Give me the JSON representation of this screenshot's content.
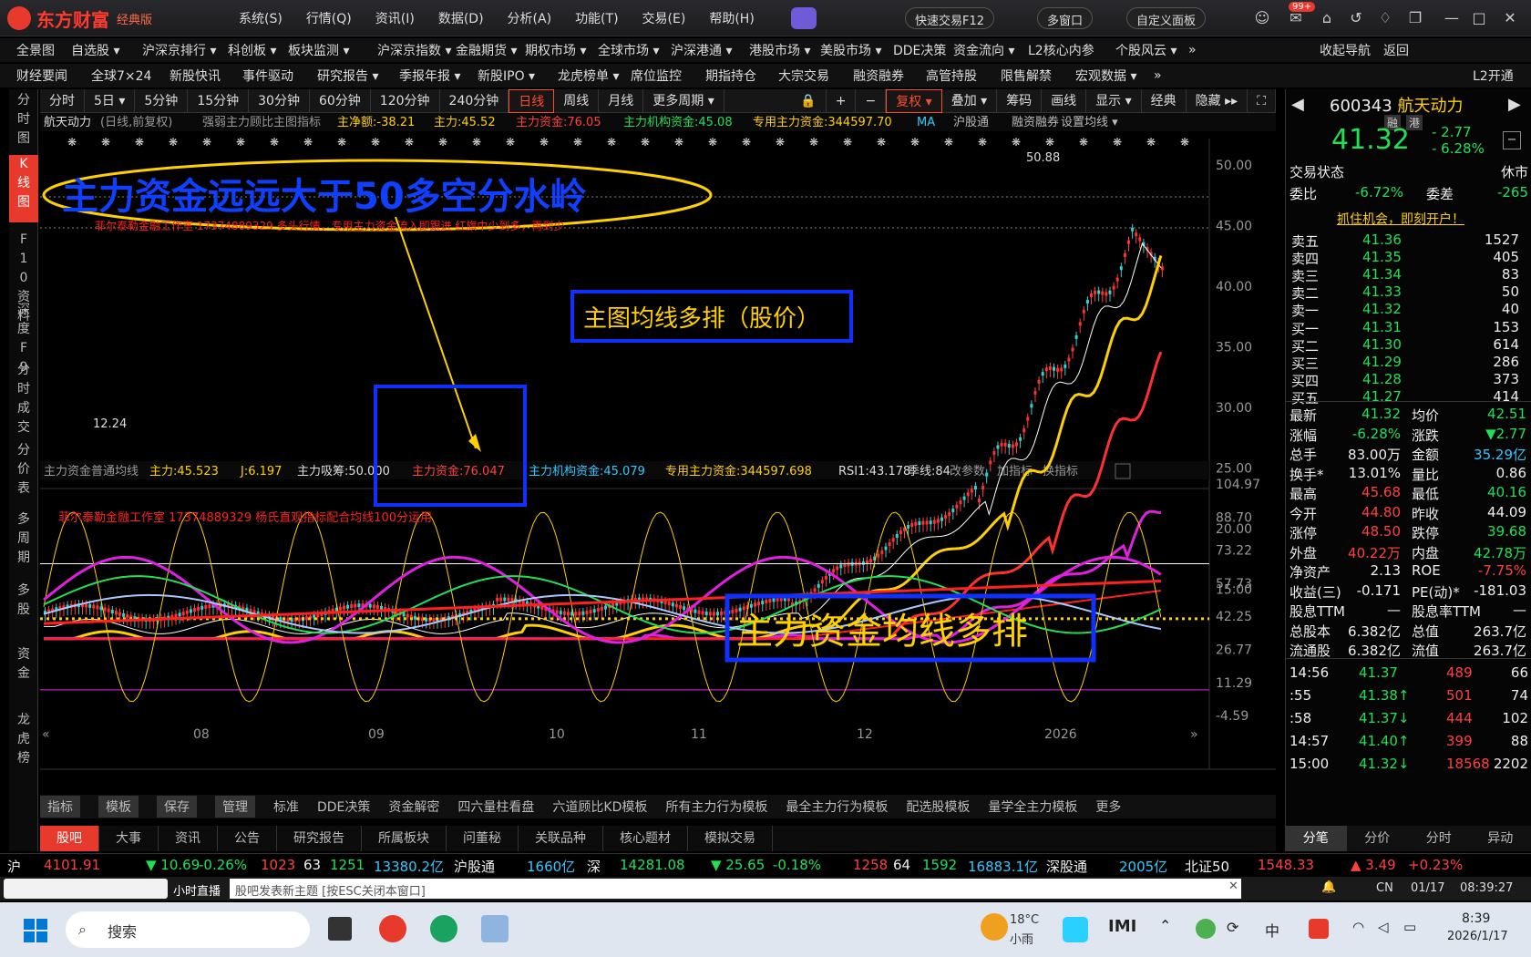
{
  "app": {
    "logo": "东方财富",
    "edition": "经典版"
  },
  "menu": [
    "系统(S)",
    "行情(Q)",
    "资讯(I)",
    "数据(D)",
    "分析(A)",
    "功能(T)",
    "交易(E)",
    "帮助(H)"
  ],
  "topbtns": {
    "quick": "快速交易F12",
    "multi": "多窗口",
    "custom": "自定义面板",
    "badge": "99+"
  },
  "nav1": [
    "全景图",
    "自选股 ▾",
    "沪深京排行 ▾",
    "科创板 ▾",
    "板块监测 ▾",
    "沪深京指数 ▾",
    "金融期货 ▾",
    "期权市场 ▾",
    "全球市场 ▾",
    "沪深港通 ▾",
    "港股市场 ▾",
    "美股市场 ▾",
    "DDE决策",
    "资金流向 ▾",
    "L2核心内参",
    "个股风云 ▾",
    "»",
    "收起导航",
    "返回"
  ],
  "nav2": [
    "财经要闻",
    "全球7×24",
    "新股快讯",
    "事件驱动",
    "研究报告 ▾",
    "季报年报 ▾",
    "新股IPO ▾",
    "龙虎榜单 ▾",
    "席位监控",
    "期指持仓",
    "大宗交易",
    "融资融券",
    "高管持股",
    "限售解禁",
    "宏观数据 ▾",
    "»",
    "L2开通"
  ],
  "leftbar": [
    "分时图",
    "K线图",
    "F10资料",
    "深度F9",
    "分时成交",
    "分价表",
    "多周期",
    "多股",
    "资金",
    "龙虎榜"
  ],
  "periods": [
    "分时",
    "5日 ▾",
    "5分钟",
    "15分钟",
    "30分钟",
    "60分钟",
    "120分钟",
    "240分钟",
    "日线",
    "周线",
    "月线",
    "更多周期 ▾"
  ],
  "tools": [
    "🔒",
    "+",
    "−",
    "复权 ▾",
    "叠加 ▾",
    "筹码",
    "画线",
    "显示 ▾",
    "经典",
    "隐藏 ▸▸",
    "⛶"
  ],
  "main_indicator": {
    "name": "航天动力",
    "mode": "(日线,前复权)",
    "ind": "强弱主力顾比主图指标",
    "v1": "主净额:-38.21",
    "v2": "主力:45.52",
    "v3": "主力资金:76.05",
    "v4": "主力机构资金:45.08",
    "v5": "专用主力资金:344597.70",
    "v6": "MA",
    "v7": "沪股通",
    "v8": "融资融券",
    "v9": "设置均线 ▾"
  },
  "annot": {
    "ellipse": "主力资金远远大于50多空分水岭",
    "redline": "菲尔泰勒金融工作室 17374889329 多头行情，专用主力资金流入即跟进 红旗中少到多，再到少",
    "box1": "主图均线多排（股价）",
    "box2": "主力资金均线多排",
    "sub_note": "菲尔泰勒金融工作室 17374889329 杨氏直观指标配合均线100分运用",
    "high": "50.88",
    "low": "12.24"
  },
  "sub_indicator": {
    "name": "主力资金普通均线",
    "v1": "主力:45.523",
    "v2": "J:6.197",
    "v3": "主力吸筹:50.000",
    "v4": "主力资金:76.047",
    "v5": "主力机构资金:45.079",
    "v6": "专用主力资金:344597.698",
    "v7": "RSI1:43.178",
    "v8": "季线:84",
    "b1": "改参数",
    "b2": "加指标",
    "b3": "换指标"
  },
  "price_axis": [
    "50.00",
    "45.00",
    "40.00",
    "35.00",
    "30.00",
    "25.00",
    "20.00",
    "15.00"
  ],
  "sub_axis": [
    "104.97",
    "88.70",
    "73.22",
    "57.73",
    "42.25",
    "26.77",
    "11.29",
    "-4.59"
  ],
  "time_axis": [
    "08",
    "09",
    "10",
    "11",
    "12",
    "2026"
  ],
  "bottomtabs": [
    "指标",
    "模板",
    "保存",
    "管理",
    "标准",
    "DDE决策",
    "资金解密",
    "四六量柱看盘",
    "六道顾比KD模板",
    "所有主力行为模板",
    "最全主力行为模板",
    "配选股模板",
    "量学全主力模板",
    "更多"
  ],
  "tabs2": [
    "股吧",
    "大事",
    "资讯",
    "公告",
    "研究报告",
    "所属板块",
    "问董秘",
    "关联品种",
    "核心题材",
    "模拟交易"
  ],
  "quote": {
    "code": "600343",
    "name": "航天动力",
    "tag1": "融",
    "tag2": "港",
    "price": "41.32",
    "chg": "- 2.77",
    "pct": "- 6.28%",
    "state_l": "交易状态",
    "state_r": "休市",
    "wb_l": "委比",
    "wb_v": "-6.72%",
    "wc_l": "委差",
    "wc_v": "-265",
    "ad": "抓住机会，即刻开户！"
  },
  "asks": [
    {
      "l": "卖五",
      "p": "41.36",
      "v": "1527"
    },
    {
      "l": "卖四",
      "p": "41.35",
      "v": "405"
    },
    {
      "l": "卖三",
      "p": "41.34",
      "v": "83"
    },
    {
      "l": "卖二",
      "p": "41.33",
      "v": "50"
    },
    {
      "l": "卖一",
      "p": "41.32",
      "v": "40"
    }
  ],
  "bids": [
    {
      "l": "买一",
      "p": "41.31",
      "v": "153"
    },
    {
      "l": "买二",
      "p": "41.30",
      "v": "614"
    },
    {
      "l": "买三",
      "p": "41.29",
      "v": "286"
    },
    {
      "l": "买四",
      "p": "41.28",
      "v": "373"
    },
    {
      "l": "买五",
      "p": "41.27",
      "v": "414"
    }
  ],
  "stats": [
    [
      "最新",
      "41.32",
      "均价",
      "42.51"
    ],
    [
      "涨幅",
      "-6.28%",
      "涨跌",
      "▼2.77"
    ],
    [
      "总手",
      "83.00万",
      "金额",
      "35.29亿"
    ],
    [
      "换手*",
      "13.01%",
      "量比",
      "0.86"
    ],
    [
      "最高",
      "45.68",
      "最低",
      "40.16"
    ],
    [
      "今开",
      "44.80",
      "昨收",
      "44.09"
    ],
    [
      "涨停",
      "48.50",
      "跌停",
      "39.68"
    ],
    [
      "外盘",
      "40.22万",
      "内盘",
      "42.78万"
    ],
    [
      "净资产",
      "2.13",
      "ROE",
      "-7.75%"
    ],
    [
      "收益(三)",
      "-0.171",
      "PE(动)*",
      "-181.03"
    ],
    [
      "股息TTM",
      "—",
      "股息率TTM",
      "—"
    ],
    [
      "总股本",
      "6.382亿",
      "总值",
      "263.7亿"
    ],
    [
      "流通股",
      "6.382亿",
      "流值",
      "263.7亿"
    ]
  ],
  "ticks": [
    [
      "14:56",
      "41.37",
      "489",
      "66"
    ],
    [
      ":55",
      "41.38↑",
      "501",
      "74"
    ],
    [
      ":58",
      "41.37↓",
      "444",
      "102"
    ],
    [
      "14:57",
      "41.40↑",
      "399",
      "88"
    ],
    [
      "15:00",
      "41.32↓",
      "18568",
      "2202"
    ]
  ],
  "rtabs": [
    "分笔",
    "分价",
    "分时",
    "异动"
  ],
  "ticker": {
    "a": "沪",
    "b": "4101.91",
    "c": "▼ 10.69",
    "d": "-0.26%",
    "e": "1023",
    "f": "63",
    "g": "1251",
    "h": "13380.2亿",
    "i": "沪股通",
    "j": "1660亿",
    "k": "深",
    "l": "14281.08",
    "m": "▼ 25.65",
    "n": "-0.18%",
    "o": "1258",
    "p": "64",
    "q": "1592",
    "r": "16883.1亿",
    "s": "深股通",
    "t": "2005亿",
    "u": "北证50",
    "v": "1548.33",
    "w": "▲ 3.49",
    "x": "+0.23%"
  },
  "status": {
    "live": "小时直播",
    "post": "股吧发表新主题 [按ESC关闭本窗口]",
    "cn": "CN",
    "date": "01/17",
    "time": "08:39:27"
  },
  "taskbar": {
    "search": "搜索",
    "weather": "18°C",
    "cond": "小雨",
    "clock": "8:39",
    "date": "2026/1/17"
  }
}
